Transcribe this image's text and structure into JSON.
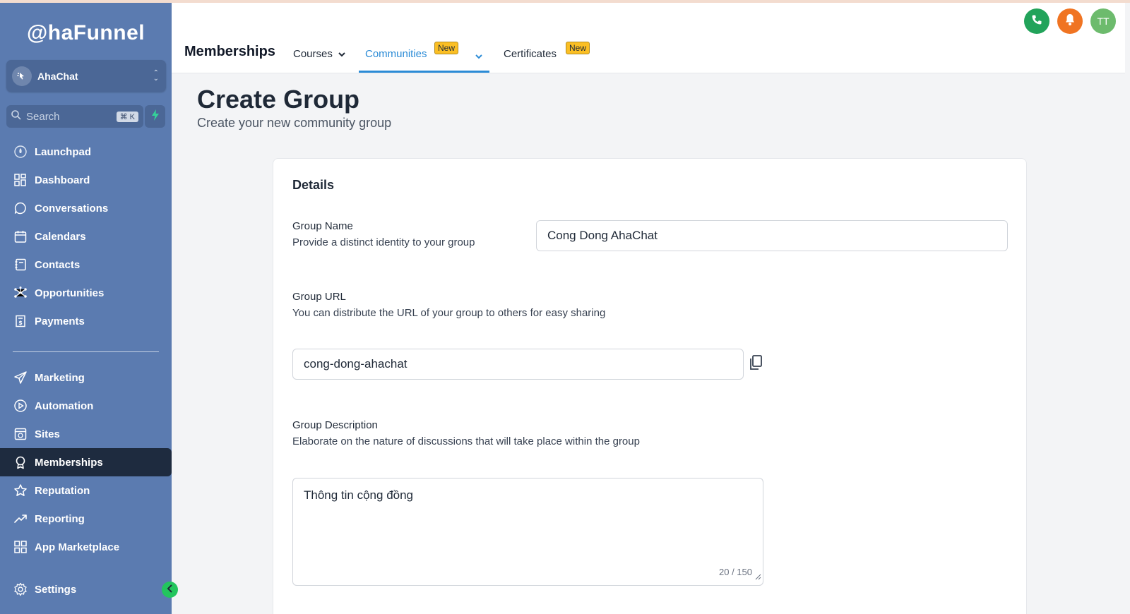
{
  "brand": {
    "logo_text": "@haFunnel"
  },
  "account": {
    "name": "AhaChat"
  },
  "search": {
    "placeholder": "Search",
    "shortcut": "⌘ K"
  },
  "sidebar": {
    "items": [
      {
        "label": "Launchpad",
        "icon": "rocket-icon"
      },
      {
        "label": "Dashboard",
        "icon": "grid-icon"
      },
      {
        "label": "Conversations",
        "icon": "chat-bubble-icon"
      },
      {
        "label": "Calendars",
        "icon": "calendar-icon"
      },
      {
        "label": "Contacts",
        "icon": "contacts-icon"
      },
      {
        "label": "Opportunities",
        "icon": "network-icon"
      },
      {
        "label": "Payments",
        "icon": "invoice-icon"
      },
      {
        "label": "Marketing",
        "icon": "send-icon"
      },
      {
        "label": "Automation",
        "icon": "play-circle-icon"
      },
      {
        "label": "Sites",
        "icon": "globe-window-icon"
      },
      {
        "label": "Memberships",
        "icon": "award-icon",
        "active": true
      },
      {
        "label": "Reputation",
        "icon": "star-icon"
      },
      {
        "label": "Reporting",
        "icon": "trend-up-icon"
      },
      {
        "label": "App Marketplace",
        "icon": "apps-grid-icon"
      },
      {
        "label": "Settings",
        "icon": "gear-icon"
      }
    ]
  },
  "header": {
    "title": "Memberships",
    "tabs": [
      {
        "label": "Courses",
        "has_dropdown": true
      },
      {
        "label": "Communities",
        "badge": "New",
        "has_dropdown": true,
        "active": true
      },
      {
        "label": "Certificates",
        "badge": "New"
      }
    ],
    "avatar_initials": "TT",
    "colors": {
      "phone": "#22a35a",
      "bell": "#f07422",
      "avatar": "#6dbb6d",
      "accent": "#2b8bd6"
    }
  },
  "page": {
    "title": "Create Group",
    "subtitle": "Create your new community group"
  },
  "form": {
    "section_title": "Details",
    "group_name": {
      "label": "Group Name",
      "description": "Provide a distinct identity to your group",
      "value": "Cong Dong AhaChat"
    },
    "group_url": {
      "label": "Group URL",
      "description": "You can distribute the URL of your group to others for easy sharing",
      "value": "cong-dong-ahachat"
    },
    "group_description": {
      "label": "Group Description",
      "description": "Elaborate on the nature of discussions that will take place within the group",
      "value": "Thông tin cộng đồng",
      "counter": "20 / 150"
    }
  }
}
